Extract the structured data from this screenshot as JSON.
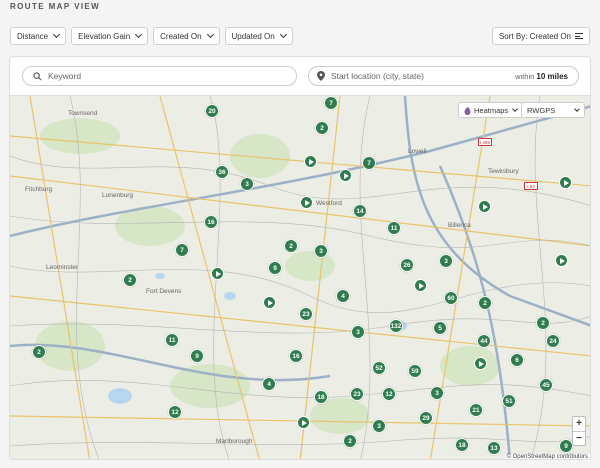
{
  "page": {
    "title": "ROUTE MAP VIEW"
  },
  "filters": [
    "Distance",
    "Elevation Gain",
    "Created On",
    "Updated On"
  ],
  "sort": {
    "label": "Sort By: Created On"
  },
  "search": {
    "placeholder": "Keyword"
  },
  "location": {
    "placeholder": "Start location (city, state)",
    "within_prefix": "within",
    "within_value": "10 miles"
  },
  "map_controls": {
    "heatmaps": "Heatmaps",
    "provider": "RWGPS",
    "zoom_in": "+",
    "zoom_out": "−"
  },
  "attribution": "© OpenStreetMap contributors",
  "towns": [
    "Townsend",
    "Fitchburg",
    "Lunenburg",
    "Leominster",
    "Fort Devens",
    "Westford",
    "Lowell",
    "Tewksbury",
    "Billerica",
    "Marlborough"
  ],
  "route_labels": [
    "I 495",
    "I 93"
  ],
  "cluster_counts": [
    "20",
    "7",
    "2",
    "36",
    "3",
    "16",
    "7",
    "2",
    "2",
    "9",
    "7",
    "14",
    "11",
    "3",
    "26",
    "3",
    "2",
    "2",
    "4",
    "60",
    "23",
    "132",
    "11",
    "9",
    "3",
    "5",
    "44",
    "16",
    "2",
    "4",
    "52",
    "59",
    "6",
    "24",
    "18",
    "23",
    "12",
    "3",
    "21",
    "45",
    "12",
    "51",
    "29",
    "3",
    "2",
    "18",
    "13",
    "9"
  ],
  "colors": {
    "marker": "#2f7d4f",
    "accent": "#2f7d4f"
  }
}
